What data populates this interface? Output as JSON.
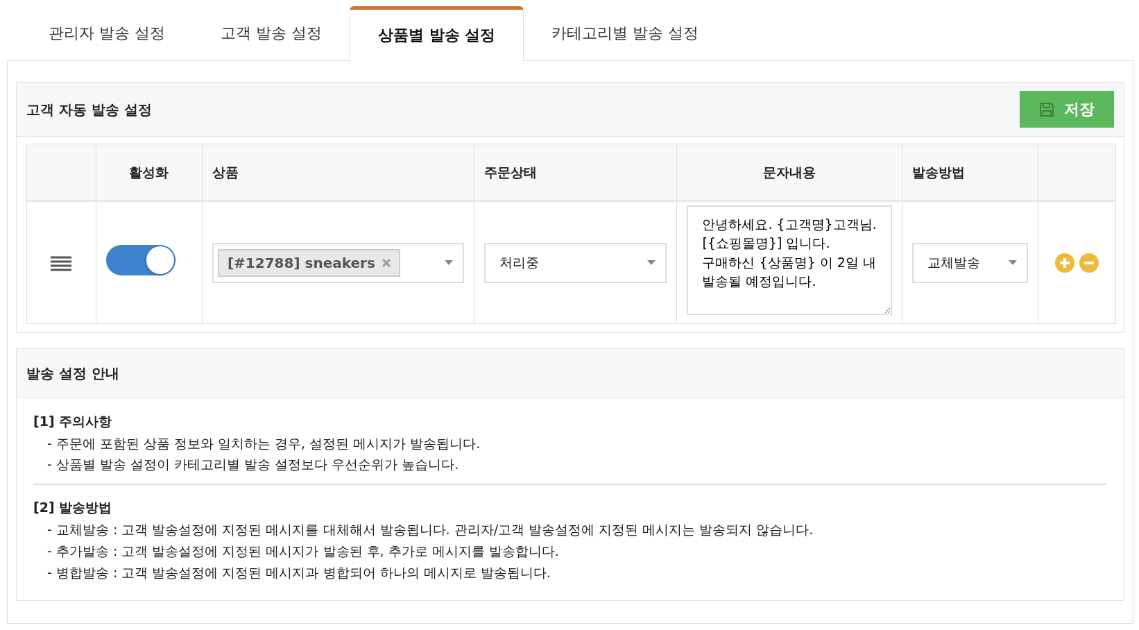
{
  "tabs": [
    {
      "label": "관리자 발송 설정",
      "selected": false
    },
    {
      "label": "고객 발송 설정",
      "selected": false
    },
    {
      "label": "상품별 발송 설정",
      "selected": true
    },
    {
      "label": "카테고리별 발송 설정",
      "selected": false
    }
  ],
  "settings_panel": {
    "title": "고객 자동 발송 설정",
    "save_button": "저장",
    "table": {
      "columns": [
        "",
        "활성화",
        "상품",
        "주문상태",
        "문자내용",
        "발송방법",
        ""
      ],
      "rows": [
        {
          "enabled": true,
          "product_tag": "[#12788] sneakers",
          "order_status": "처리중",
          "message": "안녕하세요. {고객명}고객님.\n[{쇼핑몰명}] 입니다.\n구매하신 {상품명} 이 2일 내\n발송될 예정입니다.",
          "send_method": "교체발송"
        }
      ]
    }
  },
  "guide_panel": {
    "title": "발송 설정 안내",
    "sections": [
      {
        "heading": "[1] 주의사항",
        "lines": [
          "- 주문에 포함된 상품 정보와 일치하는 경우, 설정된 메시지가 발송됩니다.",
          "- 상품별 발송 설정이 카테고리별 발송 설정보다 우선순위가 높습니다."
        ]
      },
      {
        "heading": "[2] 발송방법",
        "lines": [
          "- 교체발송 : 고객 발송설정에 지정된 메시지를 대체해서 발송됩니다. 관리자/고객 발송설정에 지정된 메시지는 발송되지 않습니다.",
          "- 추가발송 : 고객 발송설정에 지정된 메시지가 발송된 후, 추가로 메시지를 발송합니다.",
          "- 병합발송 : 고객 발송설정에 지정된 메시지과 병합되어 하나의 메시지로 발송됩니다."
        ]
      }
    ]
  }
}
